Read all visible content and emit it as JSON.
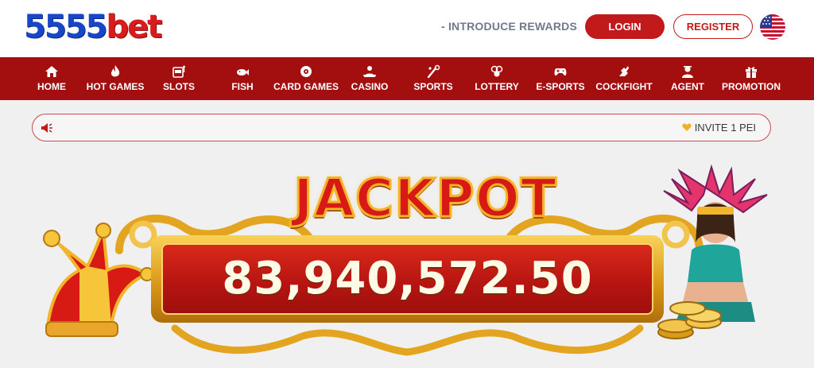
{
  "header": {
    "logo_num": "5555",
    "logo_bet": "bet",
    "intro_link": "- INTRODUCE REWARDS",
    "login_label": "LOGIN",
    "register_label": "REGISTER",
    "language_icon": "us-flag-icon"
  },
  "nav": {
    "items": [
      {
        "label": "HOME",
        "icon": "home-icon"
      },
      {
        "label": "HOT GAMES",
        "icon": "flame-icon"
      },
      {
        "label": "SLOTS",
        "icon": "slot-machine-icon"
      },
      {
        "label": "FISH",
        "icon": "fish-icon"
      },
      {
        "label": "CARD GAMES",
        "icon": "cards-icon"
      },
      {
        "label": "CASINO",
        "icon": "casino-dealer-icon"
      },
      {
        "label": "SPORTS",
        "icon": "sports-icon"
      },
      {
        "label": "LOTTERY",
        "icon": "lottery-balls-icon"
      },
      {
        "label": "E-SPORTS",
        "icon": "gamepad-icon"
      },
      {
        "label": "COCKFIGHT",
        "icon": "rooster-icon"
      },
      {
        "label": "AGENT",
        "icon": "agent-icon"
      },
      {
        "label": "PROMOTION",
        "icon": "gift-icon"
      }
    ]
  },
  "marquee": {
    "speaker_icon": "speaker-icon",
    "text": "INVITE 1 PEI"
  },
  "jackpot": {
    "title": "JACKPOT",
    "value": "83,940,572.50"
  },
  "colors": {
    "brand_red": "#a30f0f",
    "button_red": "#c21a1a",
    "logo_blue": "#1747c8",
    "gold": "#f3b428"
  }
}
